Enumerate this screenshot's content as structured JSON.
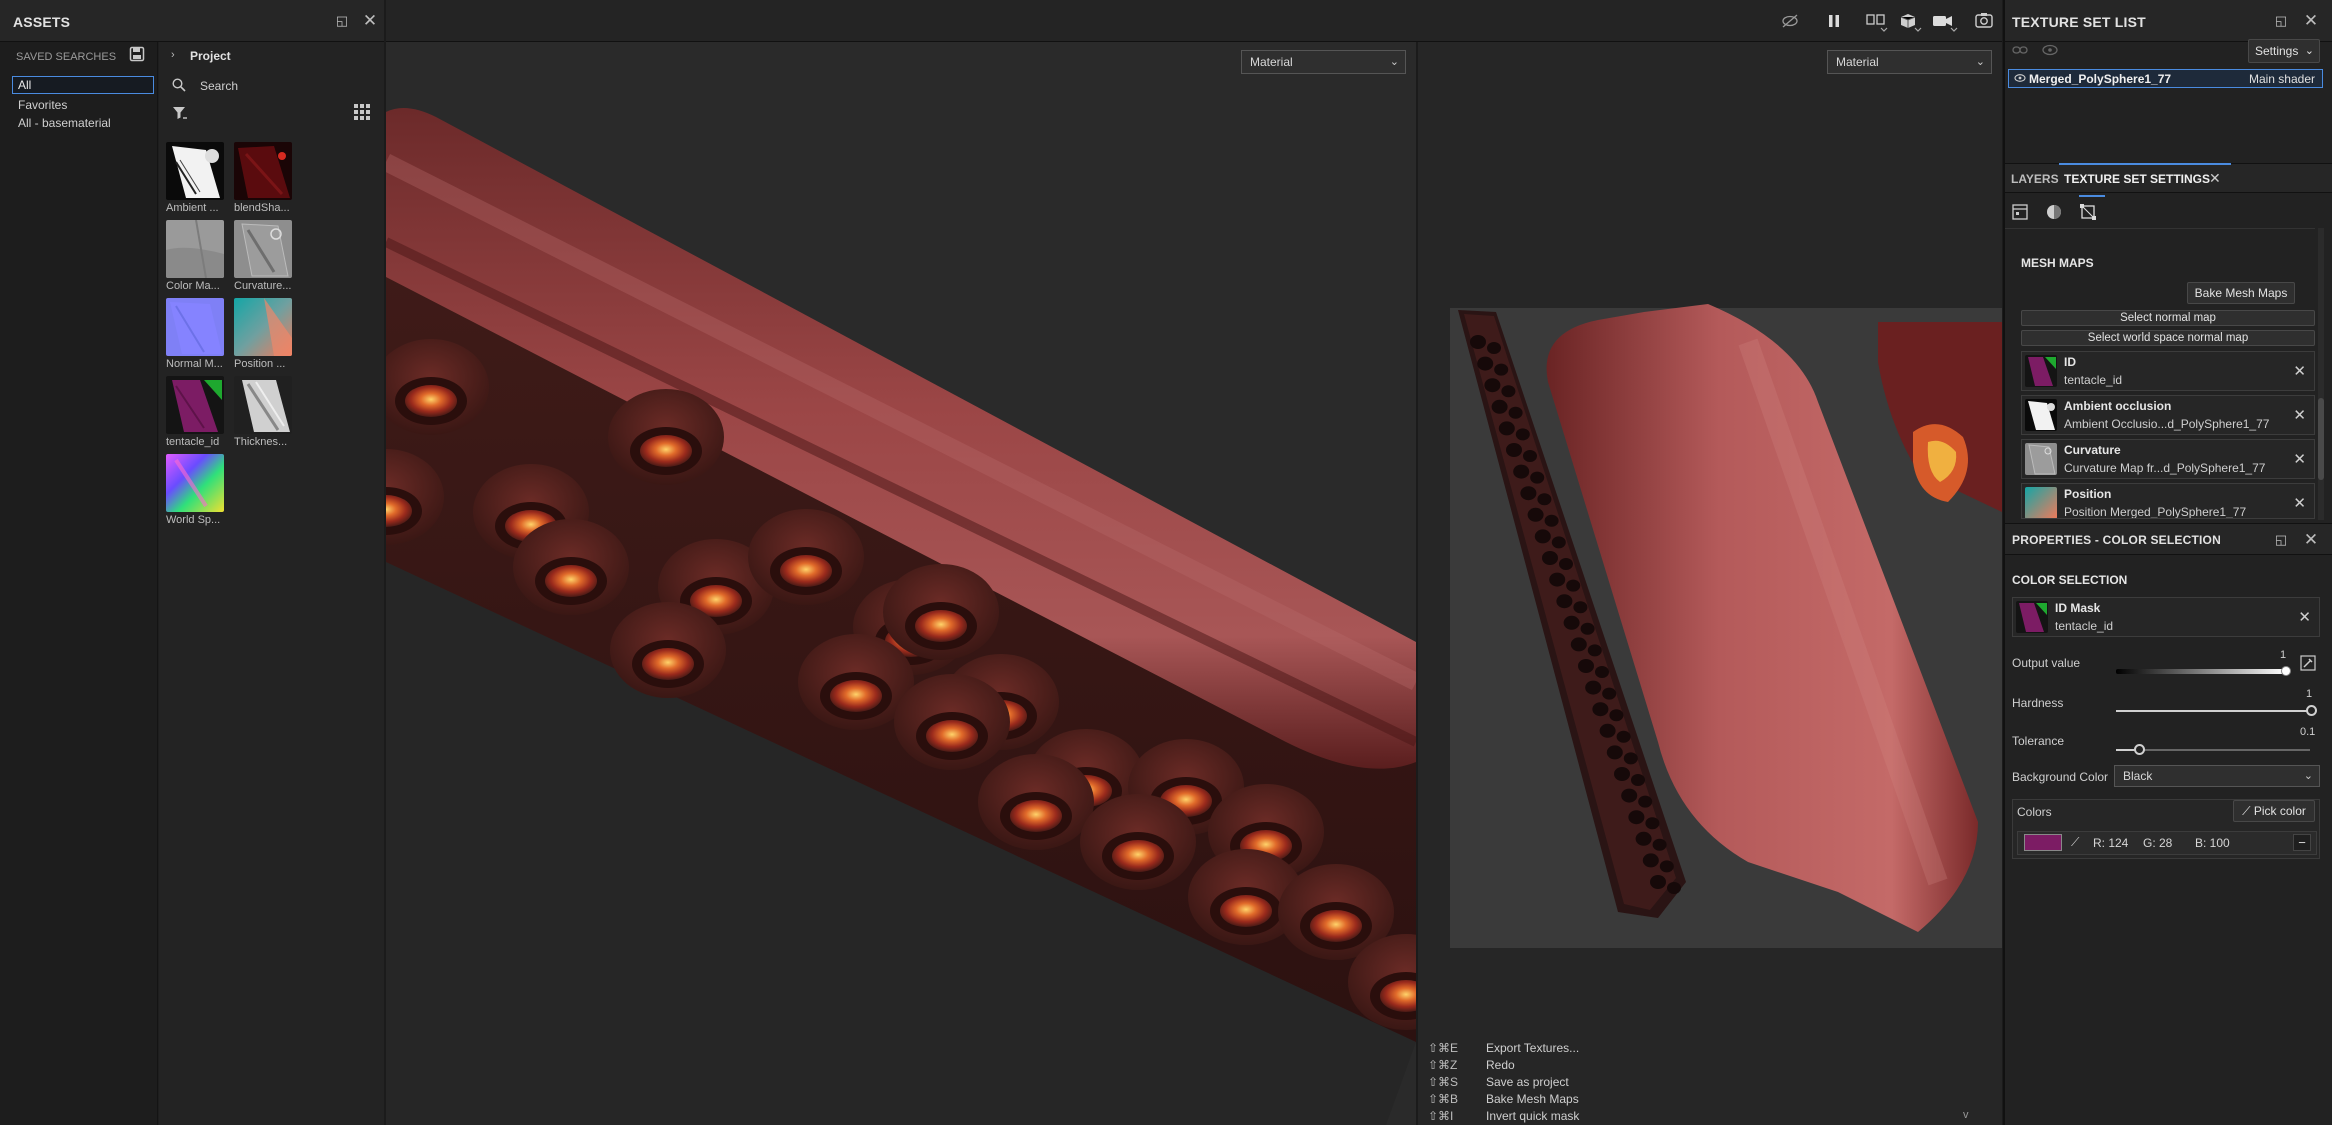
{
  "assets": {
    "title": "ASSETS",
    "saved_searches_label": "SAVED SEARCHES",
    "saved": [
      "All",
      "Favorites",
      "All - basematerial"
    ],
    "project_label": "Project",
    "search_placeholder": "Search",
    "thumbnails": [
      {
        "label": "Ambient ...",
        "icon": "ambient-occlusion-map"
      },
      {
        "label": "blendSha...",
        "icon": "blend-shape-map"
      },
      {
        "label": "Color Ma...",
        "icon": "color-map"
      },
      {
        "label": "Curvature...",
        "icon": "curvature-map"
      },
      {
        "label": "Normal M...",
        "icon": "normal-map"
      },
      {
        "label": "Position ...",
        "icon": "position-map"
      },
      {
        "label": "tentacle_id",
        "icon": "id-map"
      },
      {
        "label": "Thicknes...",
        "icon": "thickness-map"
      },
      {
        "label": "World Sp...",
        "icon": "world-space-normal-map"
      }
    ]
  },
  "viewport": {
    "left_mode": "Material",
    "right_mode": "Material",
    "toolbar_icons": [
      "hide-icon",
      "pause-icon",
      "split-view-icon",
      "cube-icon",
      "camera-icon",
      "screenshot-icon"
    ]
  },
  "shortcuts": [
    {
      "keys": "⇧⌘E",
      "action": "Export Textures..."
    },
    {
      "keys": "⇧⌘Z",
      "action": "Redo"
    },
    {
      "keys": "⇧⌘S",
      "action": "Save as project"
    },
    {
      "keys": "⇧⌘B",
      "action": "Bake Mesh Maps"
    },
    {
      "keys": "⇧⌘I",
      "action": "Invert quick mask"
    }
  ],
  "texture_set_list": {
    "title": "TEXTURE SET LIST",
    "settings_label": "Settings",
    "set_name": "Merged_PolySphere1_77",
    "shader": "Main shader"
  },
  "tabs": {
    "layers": "LAYERS",
    "texture_set_settings": "TEXTURE SET SETTINGS"
  },
  "mesh_maps": {
    "title": "MESH MAPS",
    "bake_button": "Bake Mesh Maps",
    "select_normal": "Select normal map",
    "select_world_normal": "Select world space normal map",
    "items": [
      {
        "title": "ID",
        "sub": "tentacle_id"
      },
      {
        "title": "Ambient occlusion",
        "sub": "Ambient Occlusio...d_PolySphere1_77"
      },
      {
        "title": "Curvature",
        "sub": "Curvature Map fr...d_PolySphere1_77"
      },
      {
        "title": "Position",
        "sub": "Position Merged_PolySphere1_77"
      }
    ]
  },
  "properties": {
    "title": "PROPERTIES - COLOR SELECTION",
    "section": "COLOR SELECTION",
    "id_mask_title": "ID Mask",
    "id_mask_sub": "tentacle_id",
    "output_label": "Output value",
    "output_value": "1",
    "hardness_label": "Hardness",
    "hardness_value": "1",
    "tolerance_label": "Tolerance",
    "tolerance_value": "0.1",
    "background_label": "Background Color",
    "background_value": "Black",
    "colors_label": "Colors",
    "pick_color_label": "Pick color",
    "color_swatch": "#7c1c64",
    "r_text": "R: 124",
    "g_text": "G: 28",
    "b_text": "B: 100"
  },
  "status_caret": "v"
}
